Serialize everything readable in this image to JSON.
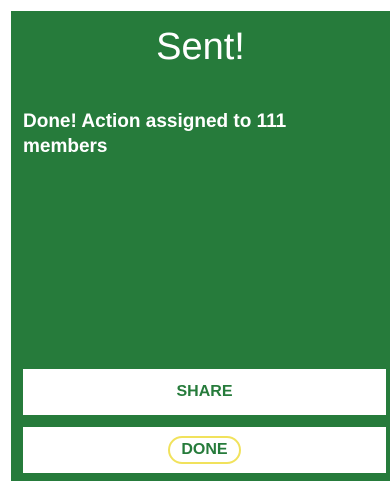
{
  "dialog": {
    "title": "Sent!",
    "message": "Done! Action assigned to 111 members"
  },
  "buttons": {
    "share_label": "SHARE",
    "done_label": "DONE"
  },
  "colors": {
    "background": "#267b3b",
    "button": "#ffffff",
    "button_text": "#267b3b",
    "done_highlight": "#f1e25c"
  }
}
